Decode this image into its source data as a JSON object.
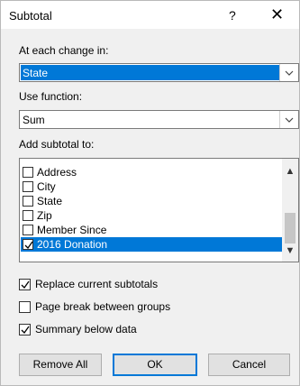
{
  "dialog": {
    "title": "Subtotal",
    "help_label": "?",
    "close_label": "✕"
  },
  "change_in": {
    "label": "At each change in:",
    "value": "State"
  },
  "function": {
    "label": "Use function:",
    "value": "Sum"
  },
  "add_to": {
    "label": "Add subtotal to:",
    "items": [
      {
        "label": "Address",
        "checked": false,
        "selected": false
      },
      {
        "label": "City",
        "checked": false,
        "selected": false
      },
      {
        "label": "State",
        "checked": false,
        "selected": false
      },
      {
        "label": "Zip",
        "checked": false,
        "selected": false
      },
      {
        "label": "Member Since",
        "checked": false,
        "selected": false
      },
      {
        "label": "2016 Donation",
        "checked": true,
        "selected": true
      }
    ]
  },
  "options": {
    "replace": {
      "label": "Replace current subtotals",
      "checked": true
    },
    "page_break": {
      "label": "Page break between groups",
      "checked": false
    },
    "summary": {
      "label": "Summary below data",
      "checked": true
    }
  },
  "buttons": {
    "remove_all": "Remove All",
    "ok": "OK",
    "cancel": "Cancel"
  }
}
